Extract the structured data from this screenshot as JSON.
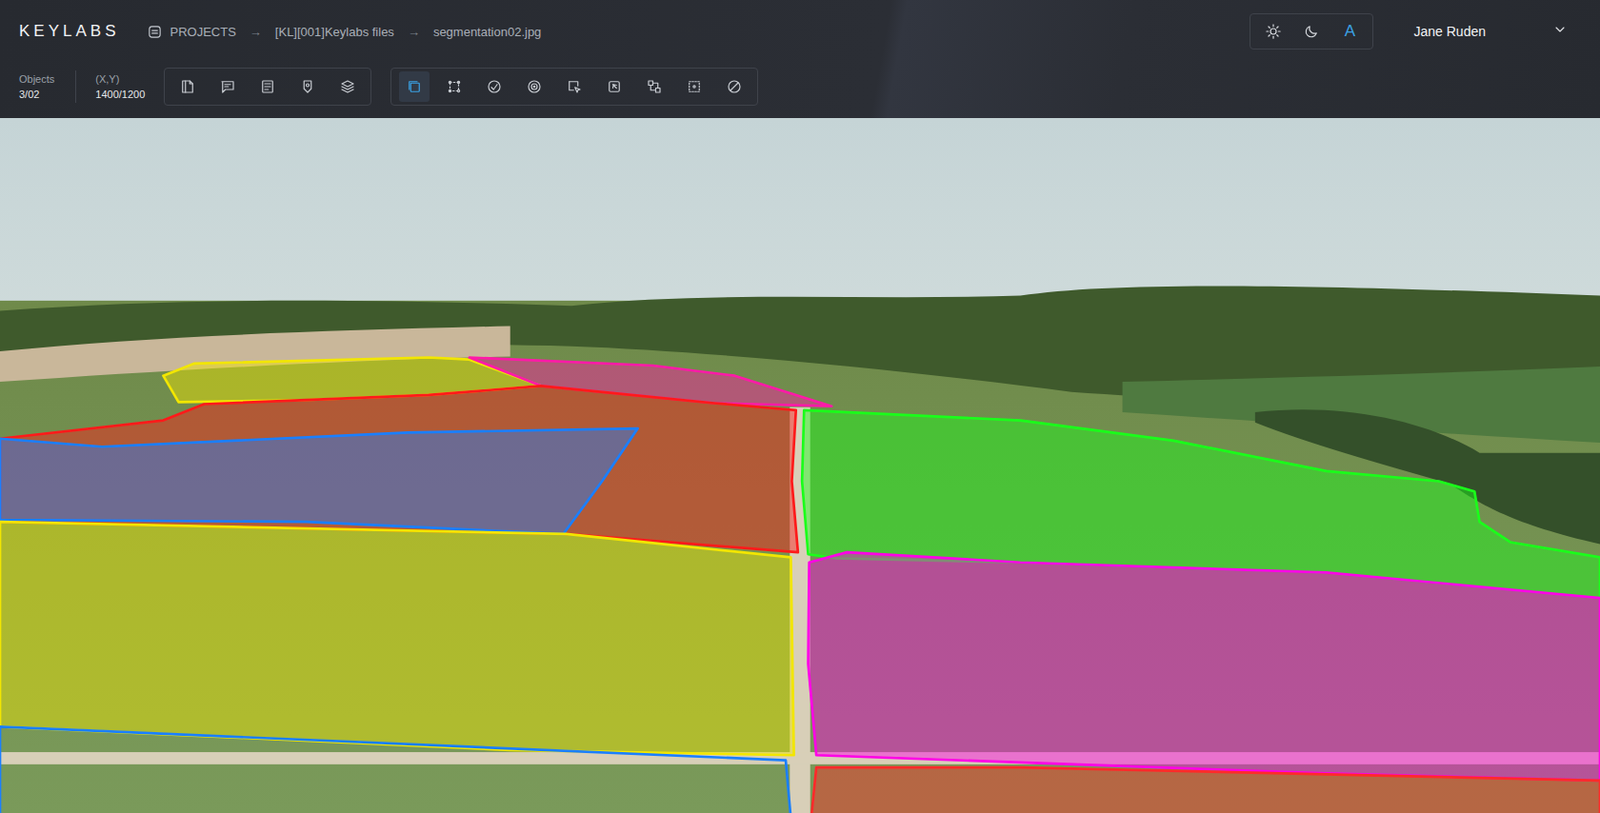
{
  "logo": "KEYLABS",
  "breadcrumb": {
    "separator": "→",
    "items": [
      "PROJECTS",
      "[KL][001]Keylabs files",
      "segmentation02.jpg"
    ]
  },
  "theme": [
    {
      "kind": "sun",
      "selected": false
    },
    {
      "kind": "moon",
      "selected": false
    },
    {
      "kind": "text",
      "label": "A",
      "selected": true
    }
  ],
  "user": {
    "name": "Jane Ruden"
  },
  "stats": [
    {
      "label": "Objects",
      "value": "3/02"
    },
    {
      "label": "(X,Y)",
      "value": "1400/1200"
    }
  ],
  "tool_groups": [
    [
      {
        "selected": false
      },
      {
        "selected": false
      },
      {
        "selected": false
      },
      {
        "selected": false
      },
      {
        "selected": false
      }
    ],
    [
      {
        "selected": true
      },
      {
        "selected": false
      },
      {
        "selected": false
      },
      {
        "selected": false
      },
      {
        "selected": false
      },
      {
        "selected": false
      },
      {
        "selected": false
      },
      {
        "selected": false
      },
      {
        "selected": false
      }
    ]
  ],
  "annotations": [
    {
      "color": "#f2e600"
    },
    {
      "color": "#ff1aa8"
    },
    {
      "color": "#ff1a1a"
    },
    {
      "color": "#1a7fff"
    },
    {
      "color": "#1aff1a"
    },
    {
      "color": "#f2e600"
    },
    {
      "color": "#ff00e6"
    },
    {
      "color": "#ff2a2a"
    },
    {
      "color": "#1a7fff"
    }
  ]
}
